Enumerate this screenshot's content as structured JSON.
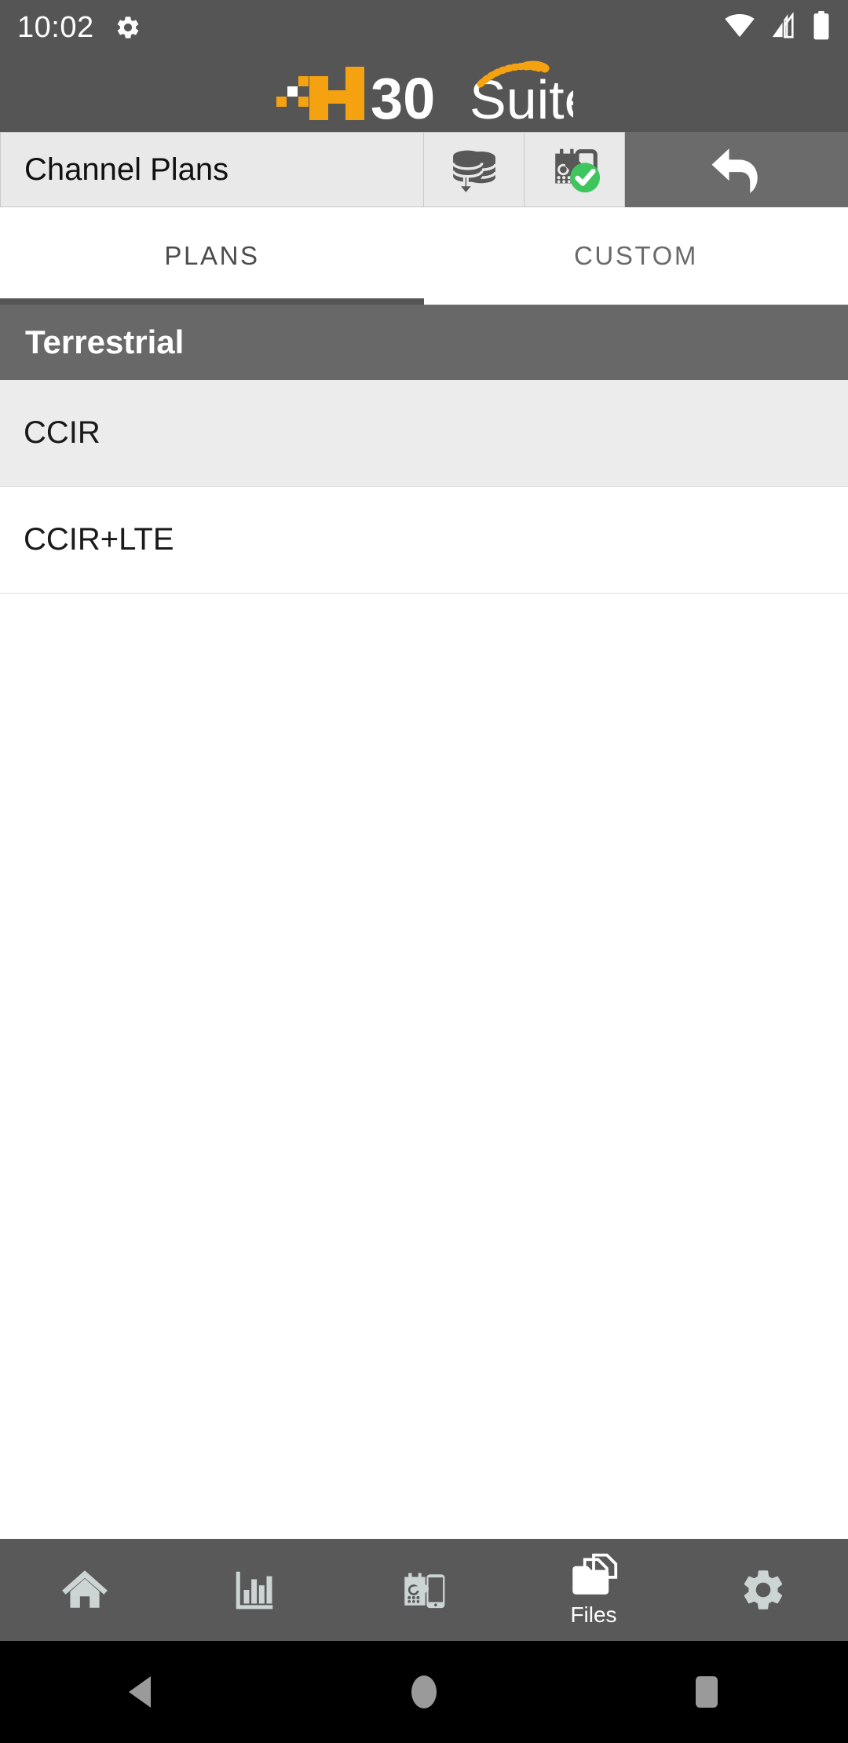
{
  "status_bar": {
    "time": "10:02",
    "gear_icon": "gear-icon",
    "wifi_icon": "wifi-icon",
    "signal_icon": "cell-signal-icon",
    "battery_icon": "battery-full-icon",
    "background": "#555555"
  },
  "logo": {
    "mark_text": "H",
    "number_text": "30",
    "suite_text": "Suite",
    "accent_color": "#F5A211",
    "text_color": "#FFFFFF"
  },
  "toolbar": {
    "title": "Channel Plans",
    "buttons": [
      {
        "name": "database-download-button",
        "icon": "database-download-icon"
      },
      {
        "name": "device-sync-ok-button",
        "icon": "device-sync-check-icon",
        "badge_color": "#3FC55E"
      },
      {
        "name": "back-button",
        "icon": "back-arrow-icon"
      }
    ]
  },
  "tabs": [
    {
      "label": "PLANS",
      "active": true
    },
    {
      "label": "CUSTOM",
      "active": false
    }
  ],
  "section": {
    "header": "Terrestrial"
  },
  "plans": [
    {
      "label": "CCIR",
      "selected": true
    },
    {
      "label": "CCIR+LTE",
      "selected": false
    }
  ],
  "bottom_nav": [
    {
      "name": "nav-home",
      "icon": "home-icon",
      "label": "",
      "active": false
    },
    {
      "name": "nav-measurements",
      "icon": "bar-chart-icon",
      "label": "",
      "active": false
    },
    {
      "name": "nav-transfer",
      "icon": "device-transfer-icon",
      "label": "",
      "active": false
    },
    {
      "name": "nav-files",
      "icon": "files-folder-icon",
      "label": "Files",
      "active": true
    },
    {
      "name": "nav-settings",
      "icon": "gear-icon",
      "label": "",
      "active": false
    }
  ],
  "android_nav": {
    "back": "triangle-back-icon",
    "home": "circle-home-icon",
    "recents": "square-recents-icon"
  },
  "colors": {
    "header_bg": "#555555",
    "toolbar_bg": "#6b6b6b",
    "section_bg": "#686868",
    "nav_bg": "#595959",
    "nav_icon": "#ccd4d4",
    "selected_row": "#ececec"
  }
}
